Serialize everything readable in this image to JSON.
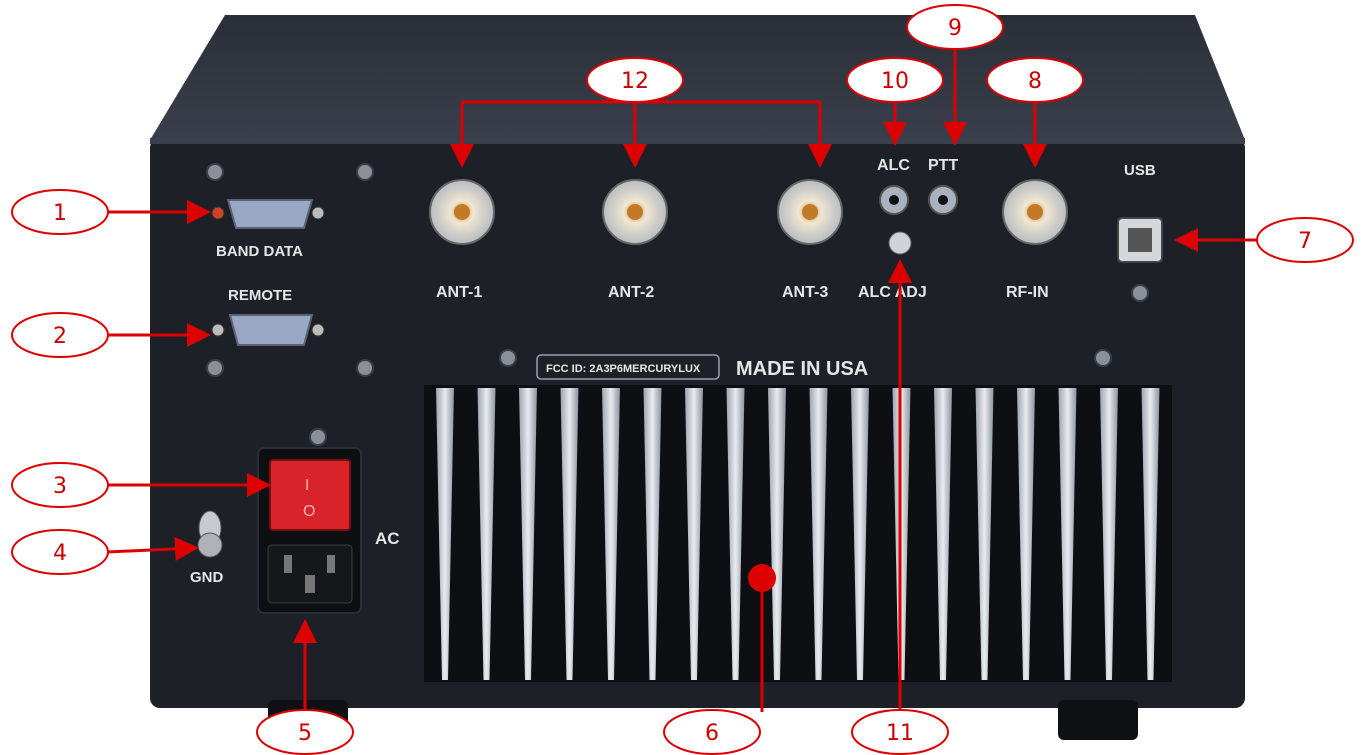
{
  "panel": {
    "labels": {
      "band_data": "BAND DATA",
      "remote": "REMOTE",
      "ant1": "ANT-1",
      "ant2": "ANT-2",
      "ant3": "ANT-3",
      "alc": "ALC",
      "ptt": "PTT",
      "alc_adj": "ALC ADJ",
      "rf_in": "RF-IN",
      "usb": "USB",
      "ac": "AC",
      "gnd": "GND",
      "fcc_id": "FCC ID: 2A3P6MERCURYLUX",
      "made_in": "MADE IN USA"
    },
    "switch": {
      "on": "I",
      "off": "O"
    }
  },
  "callouts": [
    "1",
    "2",
    "3",
    "4",
    "5",
    "6",
    "7",
    "8",
    "9",
    "10",
    "11",
    "12"
  ],
  "colors": {
    "callout": "#dd0000",
    "body": "#1d2027",
    "switch": "#d8232a"
  }
}
